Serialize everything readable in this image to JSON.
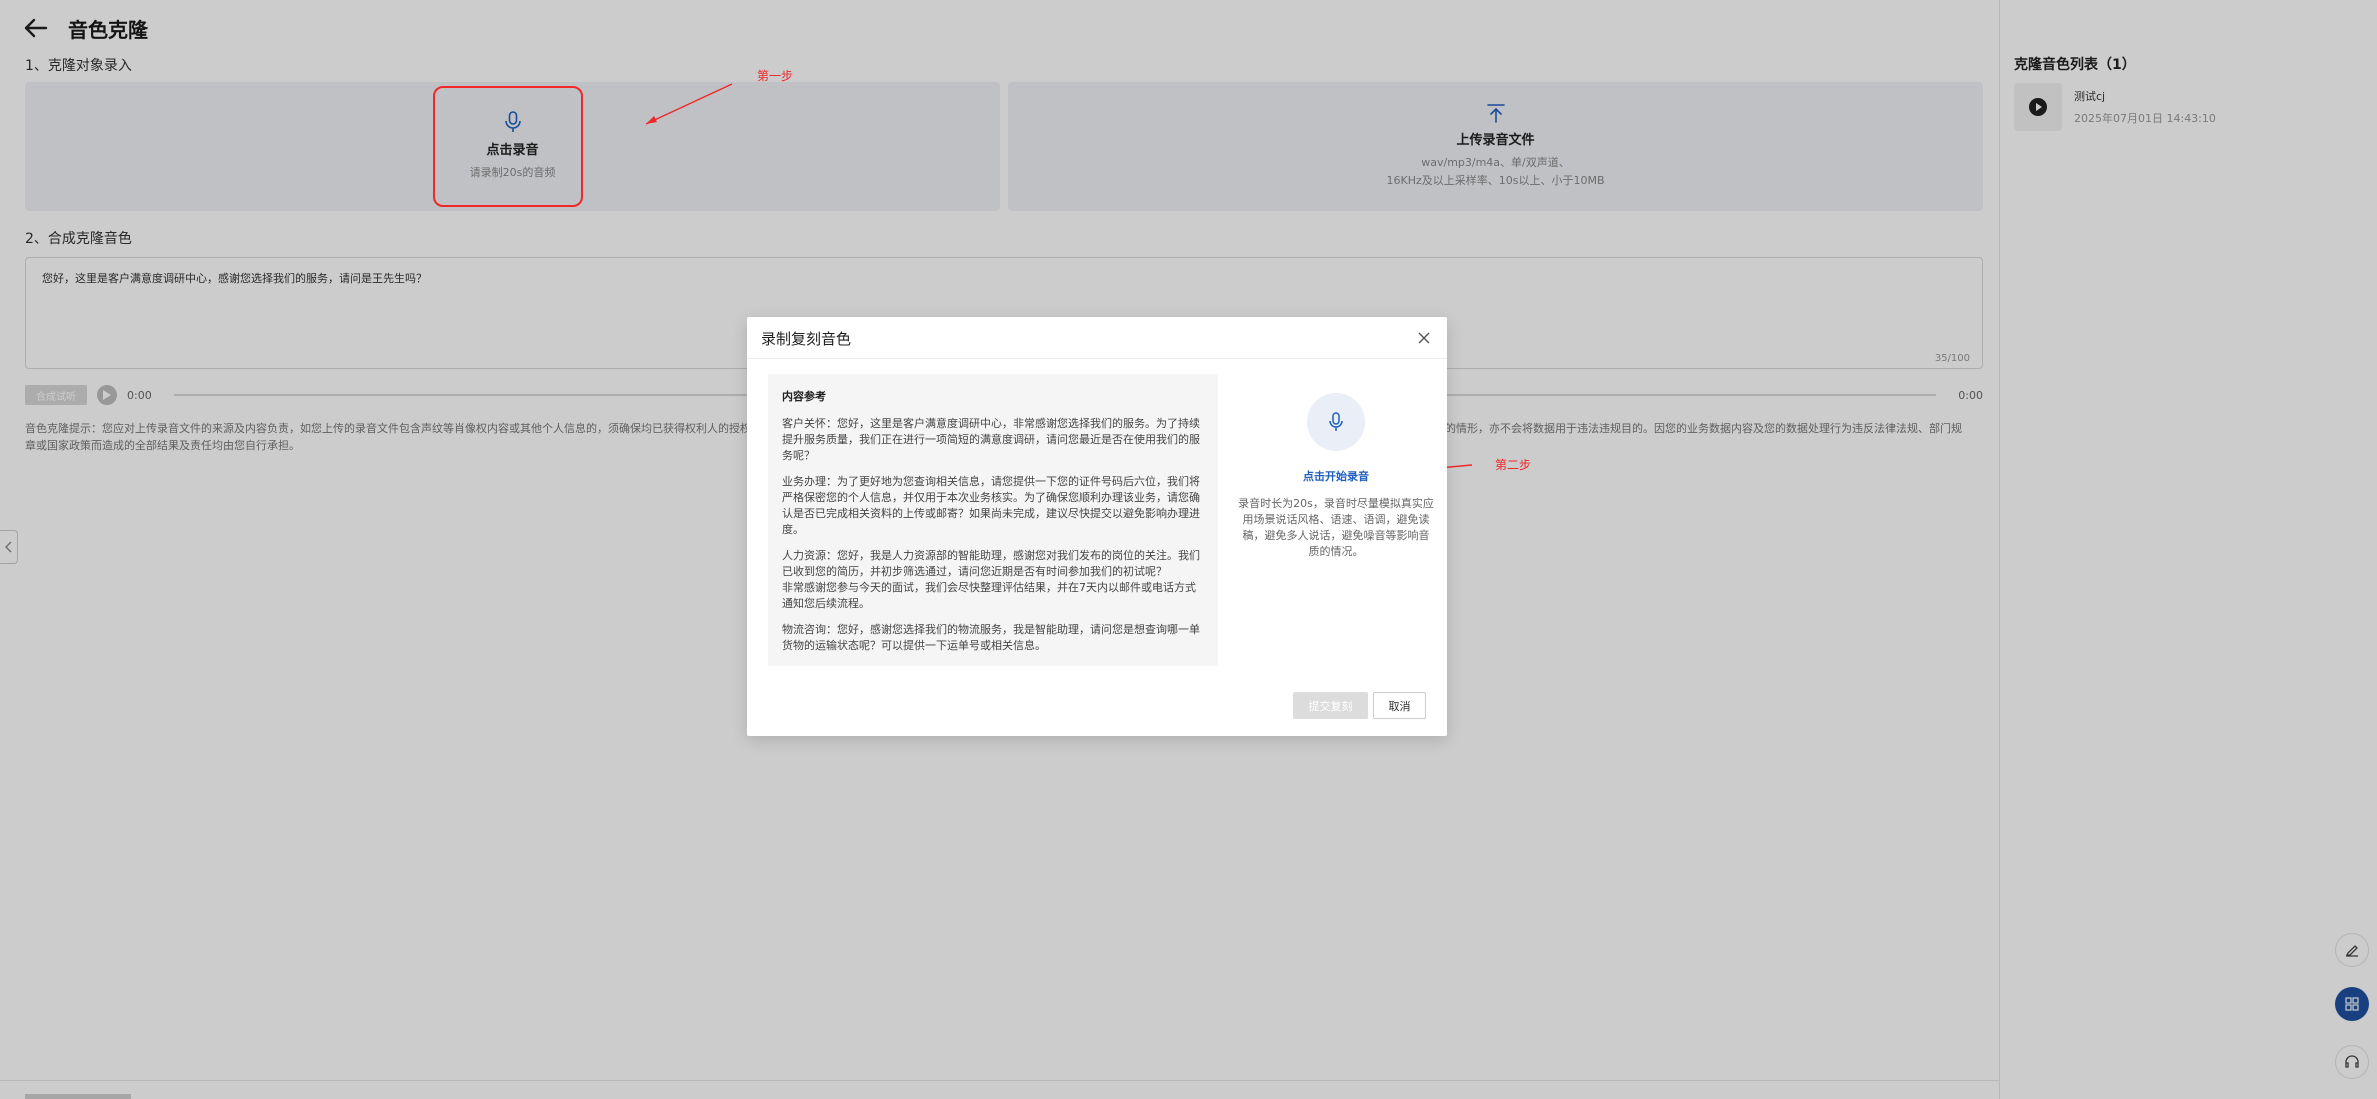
{
  "header": {
    "title": "音色克隆"
  },
  "section1": {
    "label": "1、克隆对象录入",
    "record_card": {
      "title": "点击录音",
      "sub": "请录制20s的音频"
    },
    "upload_card": {
      "title": "上传录音文件",
      "sub_line1": "wav/mp3/m4a、单/双声道、",
      "sub_line2": "16KHz及以上采样率、10s以上、小于10MB"
    }
  },
  "section2": {
    "label": "2、合成克隆音色",
    "text_value": "您好，这里是客户满意度调研中心，感谢您选择我们的服务，请问是王先生吗？",
    "char_count": "35/100"
  },
  "player": {
    "button_label": "合成试听",
    "current_time": "0:00",
    "end_time": "0:00"
  },
  "notice": {
    "line1": "音色克隆提示：您应对上传录音文件的来源及内容负责，如您上传的录音文件包含声纹等肖像权内容或其他个人信息的，须确保均已获得权利人的授权同意",
    "line1_tail": "的定的情形，亦不会将数据用于违法违规目的。因您的业务数据内容及您的数据处理行为违反法律法规、部门规",
    "line2": "章或国家政策而造成的全部结果及责任均由您自行承担。"
  },
  "right_panel": {
    "title": "克隆音色列表（1）",
    "voices": [
      {
        "name": "测试cj",
        "time": "2025年07月01日 14:43:10"
      }
    ]
  },
  "annotations": {
    "step1": "第一步",
    "step2": "第二步"
  },
  "modal": {
    "title": "录制复刻音色",
    "ref_title": "内容参考",
    "paragraphs": [
      "客户关怀：您好，这里是客户满意度调研中心，非常感谢您选择我们的服务。为了持续提升服务质量，我们正在进行一项简短的满意度调研，请问您最近是否在使用我们的服务呢？",
      "业务办理：为了更好地为您查询相关信息，请您提供一下您的证件号码后六位，我们将严格保密您的个人信息，并仅用于本次业务核实。为了确保您顺利办理该业务，请您确认是否已完成相关资料的上传或邮寄？如果尚未完成，建议尽快提交以避免影响办理进度。",
      "人力资源：您好，我是人力资源部的智能助理，感谢您对我们发布的岗位的关注。我们已收到您的简历，并初步筛选通过，请问您近期是否有时间参加我们的初试呢？\n非常感谢您参与今天的面试，我们会尽快整理评估结果，并在7天内以邮件或电话方式通知您后续流程。",
      "物流咨询：您好，感谢您选择我们的物流服务，我是智能助理，请问您是想查询哪一单货物的运输状态呢？可以提供一下运单号或相关信息。"
    ],
    "start_record": "点击开始录音",
    "record_hint": "录音时长为20s，录音时尽量模拟真实应用场景说话风格、语速、语调，避免读稿，避免多人说话，避免噪音等影响音质的情况。",
    "submit_label": "提交复刻",
    "cancel_label": "取消"
  },
  "colors": {
    "accent": "#1f5fbf",
    "annotation": "#f02828",
    "float_active": "#1f4fa0"
  }
}
